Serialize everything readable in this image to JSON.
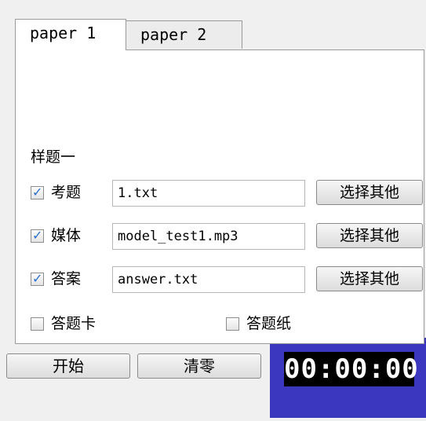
{
  "tabs": [
    {
      "label": "paper 1",
      "active": true
    },
    {
      "label": "paper 2",
      "active": false
    }
  ],
  "section_title": "样题一",
  "file_rows": [
    {
      "label": "考题",
      "checked": true,
      "value": "1.txt",
      "button": "选择其他"
    },
    {
      "label": "媒体",
      "checked": true,
      "value": "model_test1.mp3",
      "button": "选择其他"
    },
    {
      "label": "答案",
      "checked": true,
      "value": "answer.txt",
      "button": "选择其他"
    }
  ],
  "options": [
    {
      "label": "答题卡",
      "checked": false
    },
    {
      "label": "答题纸",
      "checked": false
    }
  ],
  "buttons": {
    "start": "开始",
    "clear": "清零"
  },
  "timer": {
    "display": "00:00:00"
  },
  "colors": {
    "timer_frame": "#3c37bf",
    "timer_face": "#000000",
    "timer_text": "#ffffff",
    "check_mark": "#2b6fd1"
  }
}
